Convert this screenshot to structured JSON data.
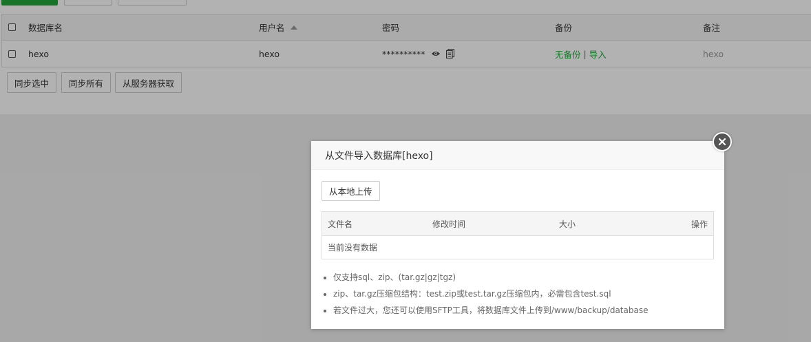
{
  "table": {
    "headers": {
      "name": "数据库名",
      "username": "用户名",
      "password": "密码",
      "backup": "备份",
      "note": "备注"
    },
    "rows": [
      {
        "name": "hexo",
        "username": "hexo",
        "password": "**********",
        "backup_status": "无备份",
        "backup_separator": "|",
        "import_label": "导入",
        "note": "hexo"
      }
    ]
  },
  "actions": {
    "sync_selected": "同步选中",
    "sync_all": "同步所有",
    "fetch_from_server": "从服务器获取"
  },
  "modal": {
    "title": "从文件导入数据库[hexo]",
    "upload_label": "从本地上传",
    "columns": {
      "filename": "文件名",
      "modified": "修改时间",
      "size": "大小",
      "ops": "操作"
    },
    "empty_text": "当前没有数据",
    "notes": [
      "仅支持sql、zip、(tar.gz|gz|tgz)",
      "zip、tar.gz压缩包结构：test.zip或test.tar.gz压缩包内，必需包含test.sql",
      "若文件过大，您还可以使用SFTP工具，将数据库文件上传到/www/backup/database"
    ]
  },
  "colors": {
    "accent_green": "#20a53a",
    "overlay": "rgba(0,0,0,0.3)"
  },
  "icons": {
    "sort": "sort-up-icon",
    "show_password": "eye-icon",
    "copy": "copy-icon",
    "close": "close-icon"
  }
}
